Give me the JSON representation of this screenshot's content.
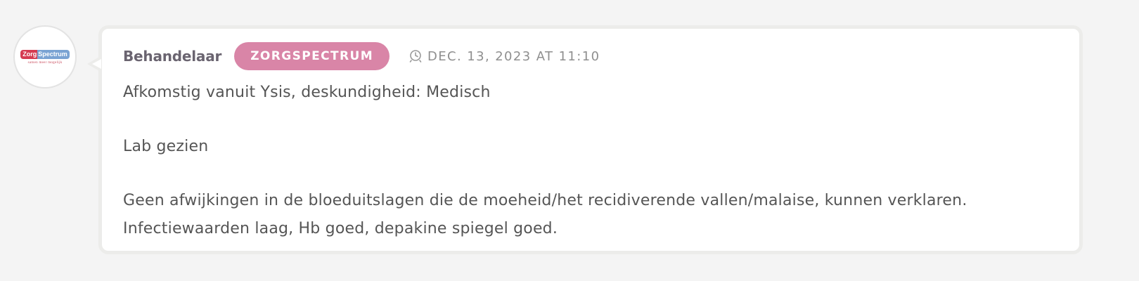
{
  "avatar": {
    "logo_text_a": "Zorg",
    "logo_text_b": "Spectrum",
    "logo_tagline": "samen meer mogelijk"
  },
  "comment": {
    "author": "Behandelaar",
    "organization_badge": "ZORGSPECTRUM",
    "timestamp": "DEC. 13, 2023 AT 11:10",
    "timestamp_icon": "clock-icon",
    "paragraphs": [
      "Afkomstig vanuit Ysis, deskundigheid: Medisch",
      "Lab gezien",
      "Geen afwijkingen in de bloeduitslagen die de moeheid/het recidiverende vallen/malaise, kunnen verklaren. Infectiewaarden laag, Hb goed, depakine spiegel goed."
    ]
  },
  "colors": {
    "page_background": "#f4f4f4",
    "bubble_border": "#ececea",
    "badge_background": "#d985a7",
    "author_text": "#6a6470",
    "body_text": "#555555",
    "timestamp_text": "#8f8f8f"
  }
}
